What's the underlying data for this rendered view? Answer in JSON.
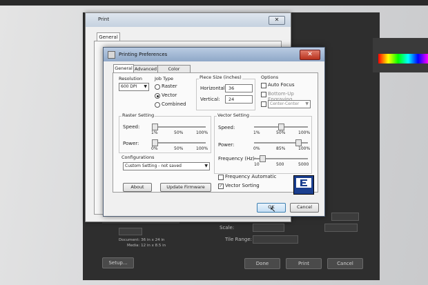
{
  "background_window": {
    "scale_label": "Scale:",
    "tile_range_label": "Tile Range:",
    "document_size": "Document: 36 in x 24 in",
    "media_size": "Media: 12 in x 8.5 in",
    "setup_label": "Setup...",
    "done_label": "Done",
    "print_label": "Print",
    "cancel_label": "Cancel"
  },
  "print_dialog": {
    "title": "Print",
    "close_symbol": "✕",
    "tab_general": "General"
  },
  "prefs": {
    "title": "Printing Preferences",
    "close_symbol": "✕",
    "tabs": [
      "General",
      "Advanced",
      "Color Mapping"
    ],
    "resolution": {
      "label": "Resolution",
      "value": "600 DPI"
    },
    "job_type": {
      "label": "Job Type",
      "options": [
        "Raster",
        "Vector",
        "Combined"
      ],
      "selected": "Vector"
    },
    "piece_size": {
      "label": "Piece Size (inches)",
      "horizontal_label": "Horizontal:",
      "horizontal_value": "36",
      "vertical_label": "Vertical:",
      "vertical_value": "24"
    },
    "options": {
      "label": "Options",
      "auto_focus": "Auto Focus",
      "bottom_up": "Bottom-Up Engraving",
      "center": "Center-Center"
    },
    "raster": {
      "label": "Raster Setting",
      "speed_label": "Speed:",
      "speed_ticks": [
        "1%",
        "50%",
        "100%"
      ],
      "speed_value": 0,
      "power_label": "Power:",
      "power_ticks": [
        "0%",
        "50%",
        "100%"
      ],
      "power_value": 0
    },
    "vector": {
      "label": "Vector Setting",
      "speed_label": "Speed:",
      "speed_ticks": [
        "1%",
        "50%",
        "100%"
      ],
      "speed_value": 50,
      "power_label": "Power:",
      "power_ticks": [
        "0%",
        "85%",
        "100%"
      ],
      "power_value": 85,
      "frequency_label": "Frequency (Hz):",
      "frequency_ticks": [
        "10",
        "500",
        "5000"
      ],
      "frequency_value": 10,
      "freq_auto_label": "Frequency Automatic",
      "freq_auto_checked": false,
      "sorting_label": "Vector Sorting",
      "sorting_checked": true
    },
    "configurations": {
      "label": "Configurations",
      "value": "Custom Setting - not saved"
    },
    "about_label": "About",
    "update_label": "Update Firmware",
    "ok_label": "OK",
    "cancel_label": "Cancel",
    "logo_text": "EPILOG LASER"
  }
}
